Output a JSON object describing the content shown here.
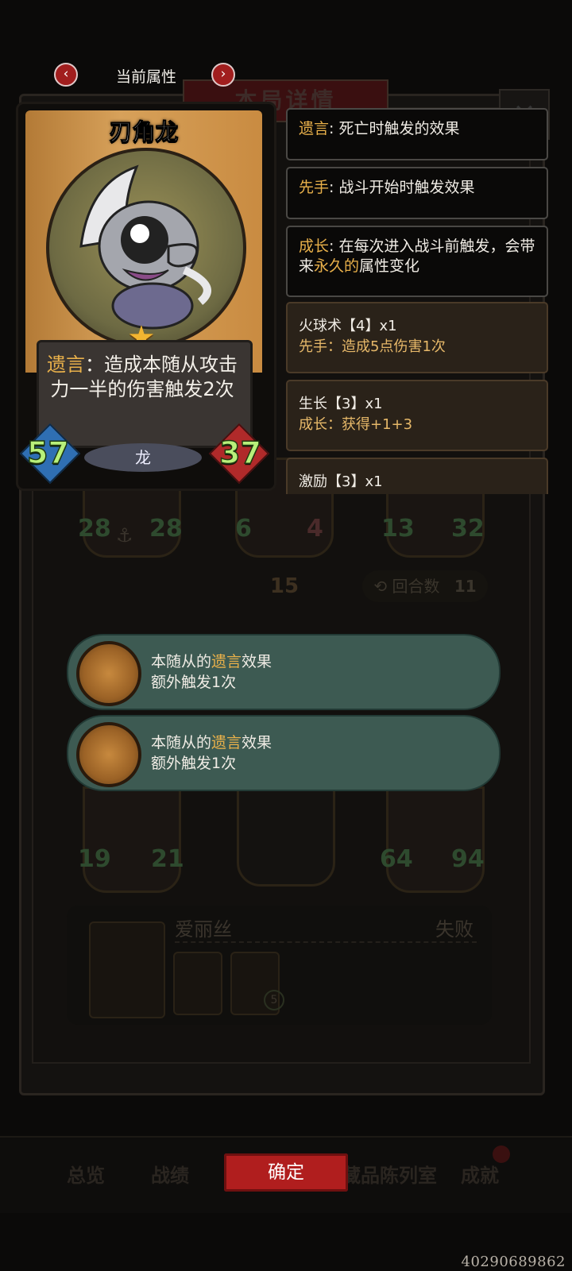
{
  "header": {
    "title": "当前属性",
    "prev_glyph": "‹",
    "next_glyph": "›"
  },
  "background": {
    "panel_title": "本局详情",
    "close_glyph": "✕",
    "units_row1": [
      {
        "atk": "28",
        "hp": "28"
      },
      {
        "atk": "6",
        "hp": "4"
      },
      {
        "atk": "13",
        "hp": "32"
      }
    ],
    "turn_marker": "15",
    "rounds_label": "回合数",
    "rounds_value": "11",
    "units_row2": [
      {
        "atk": "19",
        "hp": "21"
      },
      {
        "atk": "64",
        "hp": "94"
      }
    ],
    "opponent": {
      "name": "爱丽丝",
      "result": "失败",
      "badge": "5"
    },
    "nav": [
      "总览",
      "战绩",
      "藏品陈列室",
      "成就"
    ]
  },
  "card": {
    "name": "刃角龙",
    "desc_keyword": "遗言",
    "desc_rest": "：造成本随从攻击力一半的伤害触发2次",
    "tribe": "龙",
    "attack": "57",
    "health": "37"
  },
  "keywords": [
    {
      "keyword": "遗言",
      "text": ": 死亡时触发的效果"
    },
    {
      "keyword": "先手",
      "text": ": 战斗开始时触发效果"
    },
    {
      "keyword": "成长",
      "text_a": ": 在每次进入战斗前触发，会带来",
      "highlight": "永久的",
      "text_b": "属性变化"
    }
  ],
  "skills": [
    {
      "name": "火球术【4】x1",
      "desc": "先手：造成5点伤害1次"
    },
    {
      "name": "生长【3】x1",
      "desc": "成长：获得+1+3"
    },
    {
      "name": "激励【3】x1",
      "desc": ""
    }
  ],
  "popups": [
    {
      "line1_a": "本随从的",
      "line1_kw": "遗言",
      "line1_b": "效果",
      "line2": "额外触发1次"
    },
    {
      "line1_a": "本随从的",
      "line1_kw": "遗言",
      "line1_b": "效果",
      "line2": "额外触发1次"
    }
  ],
  "confirm_label": "确定",
  "footer_code": "40290689862",
  "colors": {
    "accent_red": "#b01e1e",
    "keyword_gold": "#e8b04a",
    "popup_teal": "#3d5a52",
    "stat_green": "#b8f07a"
  }
}
